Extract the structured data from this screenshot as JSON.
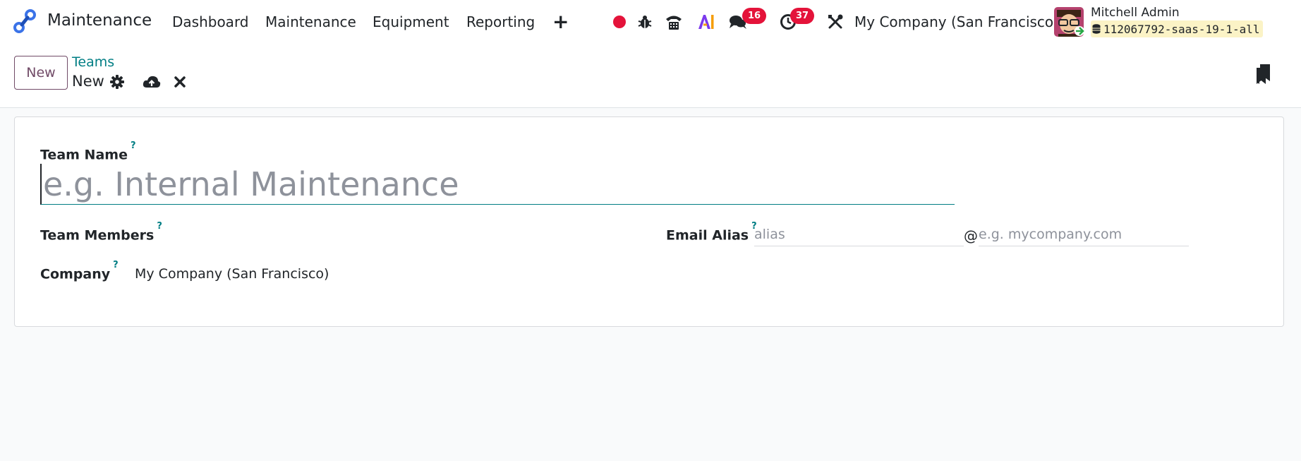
{
  "navbar": {
    "app_name": "Maintenance",
    "menu": [
      "Dashboard",
      "Maintenance",
      "Equipment",
      "Reporting"
    ],
    "messages_count": "16",
    "activities_count": "37",
    "company": "My Company (San Francisco)",
    "user_name": "Mitchell Admin",
    "database": "112067792-saas-19-1-all",
    "accent_color": "#e4133a"
  },
  "control_panel": {
    "new_label": "New",
    "breadcrumb_parent": "Teams",
    "breadcrumb_current": "New"
  },
  "form": {
    "team_name_label": "Team Name",
    "team_name_placeholder": "e.g. Internal Maintenance",
    "team_members_label": "Team Members",
    "company_label": "Company",
    "company_value": "My Company (San Francisco)",
    "email_alias_label": "Email Alias",
    "alias_placeholder": "alias",
    "at_sign": "@",
    "domain_placeholder": "e.g. mycompany.com",
    "help_mark": "?"
  }
}
